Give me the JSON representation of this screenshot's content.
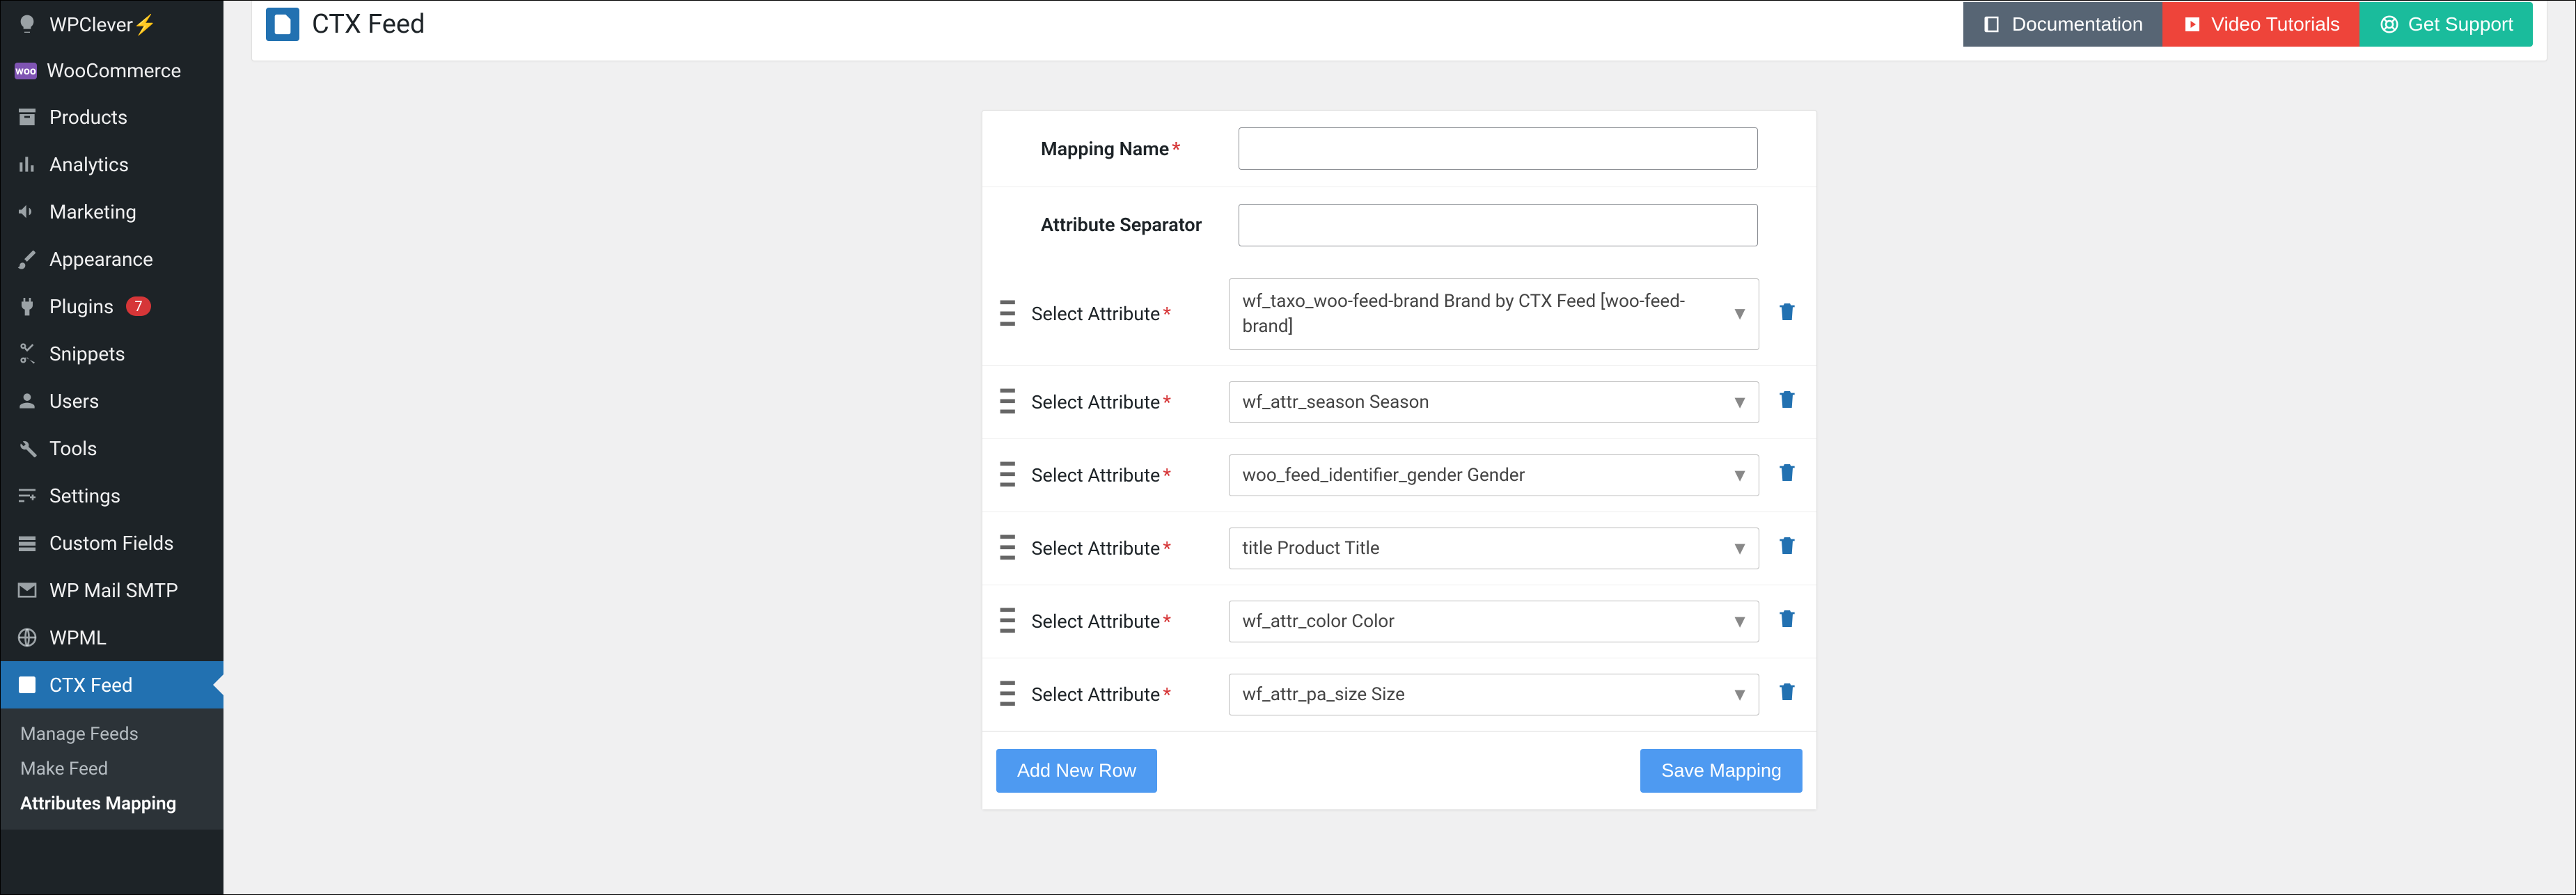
{
  "sidebar": {
    "items": [
      {
        "icon": "lightbulb",
        "label": "WPClever⚡"
      },
      {
        "icon": "woo",
        "label": "WooCommerce"
      },
      {
        "icon": "archive",
        "label": "Products"
      },
      {
        "icon": "chart",
        "label": "Analytics"
      },
      {
        "icon": "megaphone",
        "label": "Marketing"
      },
      {
        "icon": "brush",
        "label": "Appearance"
      },
      {
        "icon": "plug",
        "label": "Plugins",
        "badge": "7"
      },
      {
        "icon": "scissors",
        "label": "Snippets"
      },
      {
        "icon": "user",
        "label": "Users"
      },
      {
        "icon": "wrench",
        "label": "Tools"
      },
      {
        "icon": "sliders",
        "label": "Settings"
      },
      {
        "icon": "fields",
        "label": "Custom Fields"
      },
      {
        "icon": "mail",
        "label": "WP Mail SMTP"
      },
      {
        "icon": "globe",
        "label": "WPML"
      },
      {
        "icon": "feed",
        "label": "CTX Feed",
        "active": true
      }
    ],
    "sub": [
      {
        "label": "Manage Feeds"
      },
      {
        "label": "Make Feed"
      },
      {
        "label": "Attributes Mapping",
        "active": true
      }
    ]
  },
  "header": {
    "title": "CTX Feed",
    "buttons": {
      "docs": "Documentation",
      "vids": "Video Tutorials",
      "support": "Get Support"
    }
  },
  "form": {
    "name_label": "Mapping Name",
    "sep_label": "Attribute Separator",
    "name_value": "",
    "sep_value": "",
    "rows": [
      {
        "label": "Select Attribute",
        "value": "wf_taxo_woo-feed-brand Brand by CTX Feed [woo-feed-brand]",
        "multi": true
      },
      {
        "label": "Select Attribute",
        "value": "wf_attr_season Season"
      },
      {
        "label": "Select Attribute",
        "value": "woo_feed_identifier_gender Gender"
      },
      {
        "label": "Select Attribute",
        "value": "title Product Title"
      },
      {
        "label": "Select Attribute",
        "value": "wf_attr_color Color"
      },
      {
        "label": "Select Attribute",
        "value": "wf_attr_pa_size Size"
      }
    ],
    "add_row": "Add New Row",
    "save": "Save Mapping"
  }
}
